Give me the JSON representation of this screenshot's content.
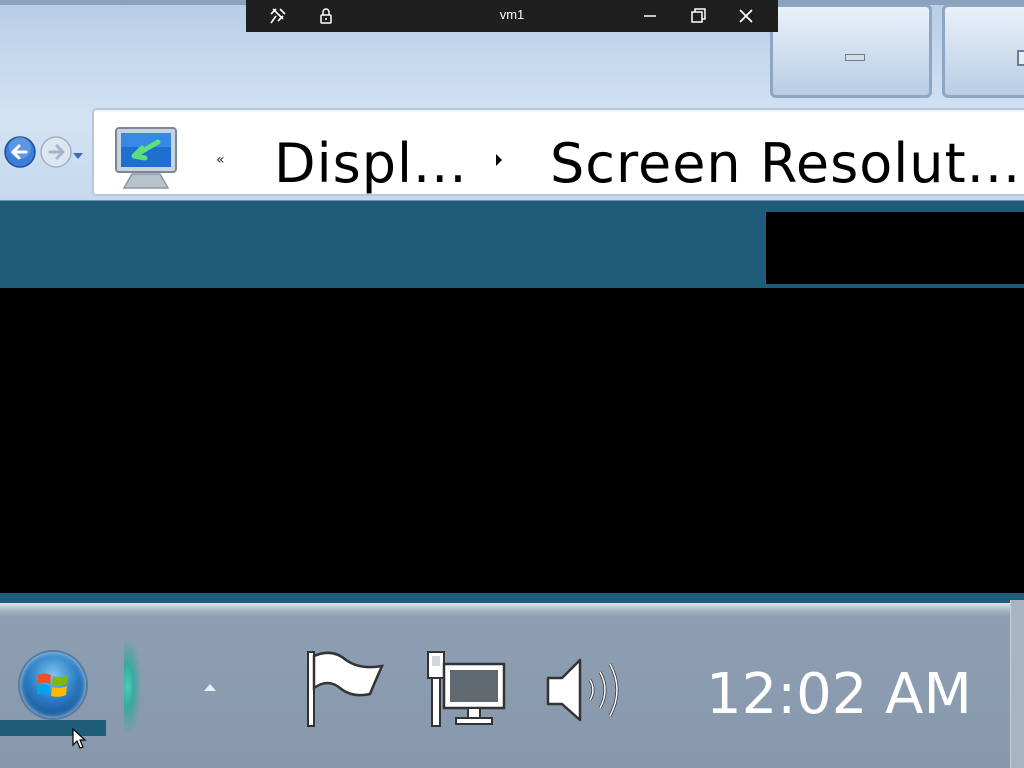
{
  "rdp": {
    "title": "vm1",
    "icons": [
      "pin-icon",
      "lock-icon",
      "minimize-icon",
      "restore-icon",
      "close-icon"
    ]
  },
  "explorer": {
    "nav": {
      "icons": [
        "back-arrow-icon",
        "forward-arrow-icon",
        "history-dropdown-icon"
      ]
    },
    "address_bar": {
      "icon": "display-control-panel-icon",
      "overflow_chevron": "«",
      "breadcrumbs": [
        "Displ...",
        "Screen Resolut..."
      ]
    },
    "caption_buttons": {
      "icons": [
        "minimize-icon",
        "maximize-icon"
      ]
    }
  },
  "taskbar": {
    "start_icon": "windows-start-orb-icon",
    "tray_icons": [
      "show-hidden-icons-arrow-icon",
      "action-center-flag-icon",
      "network-icon",
      "volume-icon"
    ],
    "clock": "12:02 AM"
  },
  "colors": {
    "glass": "#c8daef",
    "content_teal": "#1e5c7a",
    "taskbar": "#8798ac",
    "rdp_bar": "#1f1f1f"
  }
}
